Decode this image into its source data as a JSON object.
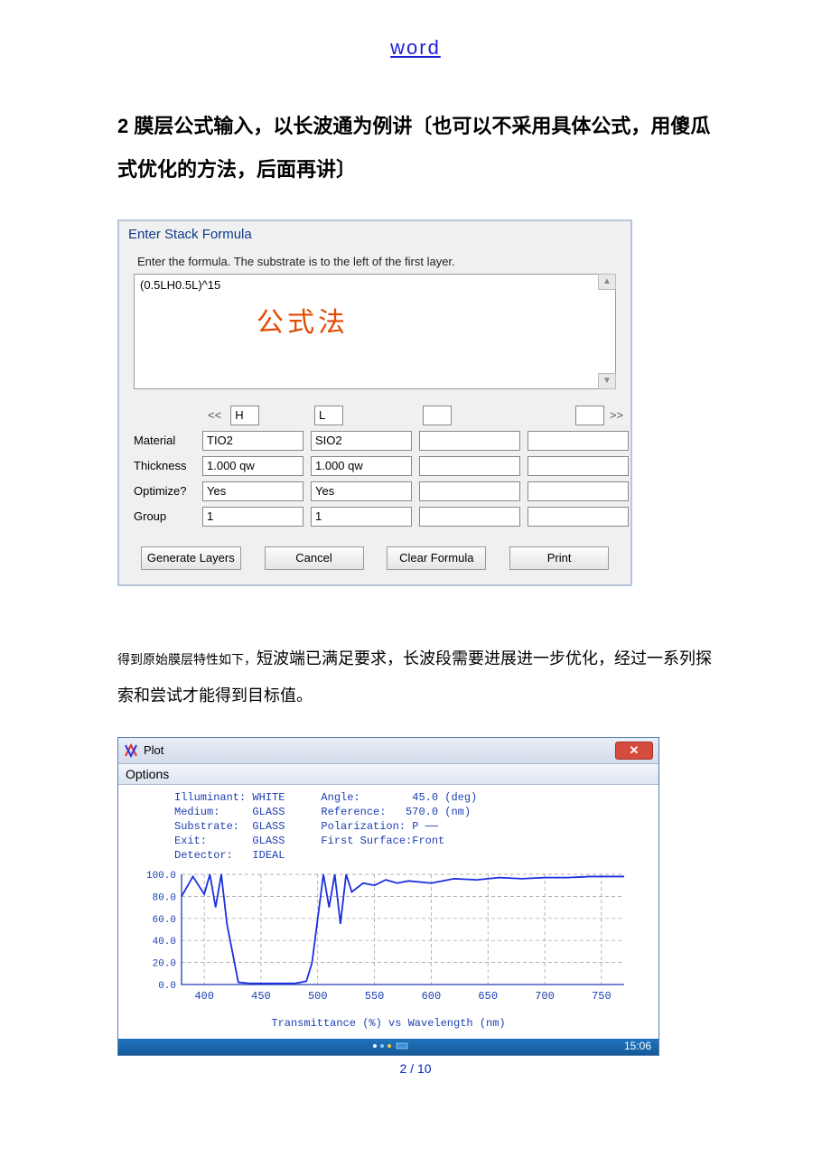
{
  "top_link": "word",
  "section_title": "2 膜层公式输入，以长波通为例讲〔也可以不采用具体公式，用傻瓜式优化的方法，后面再讲〕",
  "dialog": {
    "title": "Enter Stack Formula",
    "instruction": "Enter the formula.  The substrate is to the left of the first layer.",
    "formula_value": "(0.5LH0.5L)^15",
    "annotation": "公式法",
    "nav_prev": "<<",
    "nav_next": ">>",
    "header_H": "H",
    "header_L": "L",
    "rows": {
      "material": {
        "label": "Material",
        "H": "TIO2",
        "L": "SIO2"
      },
      "thickness": {
        "label": "Thickness",
        "H": "1.000 qw",
        "L": "1.000 qw"
      },
      "optimize": {
        "label": "Optimize?",
        "H": "Yes",
        "L": "Yes"
      },
      "group": {
        "label": "Group",
        "H": "1",
        "L": "1"
      }
    },
    "buttons": {
      "generate": "Generate Layers",
      "cancel": "Cancel",
      "clear": "Clear Formula",
      "print": "Print"
    }
  },
  "body_text_small": "得到原始膜层特性如下，",
  "body_text_main": "短波端已满足要求，长波段需要进展进一步优化，经过一系列探索和尝试才能得到目标值。",
  "plot": {
    "title": "Plot",
    "options": "Options",
    "meta_left": "Illuminant: WHITE\nMedium:     GLASS\nSubstrate:  GLASS\nExit:       GLASS\nDetector:   IDEAL",
    "meta_right": "Angle:        45.0 (deg)\nReference:   570.0 (nm)\nPolarization: P ──\nFirst Surface:Front",
    "caption": "Transmittance (%)  vs  Wavelength (nm)",
    "time": "15:06"
  },
  "chart_data": {
    "type": "line",
    "title": "Transmittance (%) vs Wavelength (nm)",
    "xlabel": "Wavelength (nm)",
    "ylabel": "Transmittance (%)",
    "xlim": [
      380,
      770
    ],
    "ylim": [
      0,
      100
    ],
    "x_ticks": [
      400,
      450,
      500,
      550,
      600,
      650,
      700,
      750
    ],
    "y_ticks": [
      0.0,
      20.0,
      40.0,
      60.0,
      80.0,
      100.0
    ],
    "series": [
      {
        "name": "P",
        "x": [
          380,
          390,
          400,
          405,
          410,
          415,
          420,
          430,
          440,
          450,
          460,
          470,
          480,
          490,
          495,
          500,
          505,
          510,
          515,
          520,
          525,
          530,
          540,
          550,
          560,
          570,
          580,
          600,
          620,
          640,
          660,
          680,
          700,
          720,
          740,
          760,
          770
        ],
        "values": [
          80,
          98,
          82,
          100,
          70,
          100,
          55,
          2,
          1,
          1,
          1,
          1,
          1,
          3,
          20,
          60,
          100,
          70,
          100,
          55,
          100,
          84,
          92,
          90,
          95,
          92,
          94,
          92,
          96,
          95,
          97,
          96,
          97,
          97,
          98,
          98,
          98
        ]
      }
    ]
  },
  "page_number": "2 / 10"
}
